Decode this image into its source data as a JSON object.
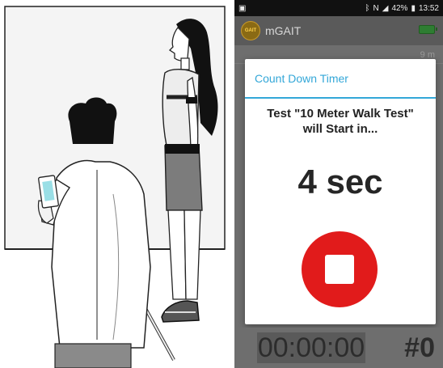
{
  "status_bar": {
    "icons": [
      "image-icon",
      "bluetooth-icon",
      "nfc-icon",
      "signal-icon",
      "battery-icon"
    ],
    "battery": "42%",
    "time": "13:52"
  },
  "app": {
    "logo_text": "GAIT",
    "title": "mGAIT",
    "bg_distance": "9 m",
    "accent_color": "#33a7d8",
    "stop_color": "#e11b1b"
  },
  "dialog": {
    "title": "Count Down Timer",
    "message_line1": "Test \"10 Meter Walk Test\"",
    "message_line2": "will Start in...",
    "countdown": "4 sec"
  },
  "footer": {
    "elapsed": "00:00:00",
    "count": "#0"
  }
}
